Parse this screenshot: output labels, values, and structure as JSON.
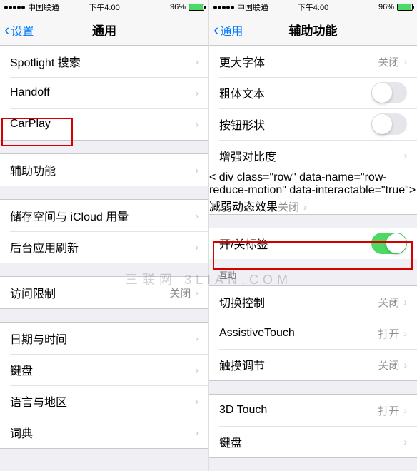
{
  "status": {
    "carrier": "中国联通",
    "time": "下午4:00",
    "battery_pct": "96%"
  },
  "left": {
    "back": "设置",
    "title": "通用",
    "g1": [
      {
        "label": "Spotlight 搜索"
      },
      {
        "label": "Handoff"
      },
      {
        "label": "CarPlay"
      }
    ],
    "g2": [
      {
        "label": "辅助功能"
      }
    ],
    "g3": [
      {
        "label": "储存空间与 iCloud 用量"
      },
      {
        "label": "后台应用刷新"
      }
    ],
    "g4": [
      {
        "label": "访问限制",
        "value": "关闭"
      }
    ],
    "g5": [
      {
        "label": "日期与时间"
      },
      {
        "label": "键盘"
      },
      {
        "label": "语言与地区"
      },
      {
        "label": "词典"
      }
    ]
  },
  "right": {
    "back": "通用",
    "title": "辅助功能",
    "g1": [
      {
        "label": "更大字体",
        "value": "关闭"
      },
      {
        "label": "粗体文本",
        "toggle": false
      },
      {
        "label": "按钮形状",
        "toggle": false
      },
      {
        "label": "增强对比度"
      },
      {
        "label": "减弱动态效果",
        "value": "关闭"
      },
      {
        "label": "开/关标签",
        "toggle": true
      }
    ],
    "section_interaction": "互动",
    "g2": [
      {
        "label": "切换控制",
        "value": "关闭"
      },
      {
        "label": "AssistiveTouch",
        "value": "打开"
      },
      {
        "label": "触摸调节",
        "value": "关闭"
      }
    ],
    "g3": [
      {
        "label": "3D Touch",
        "value": "打开"
      },
      {
        "label": "键盘"
      }
    ]
  },
  "watermark": "三联网 3LIAN.COM"
}
